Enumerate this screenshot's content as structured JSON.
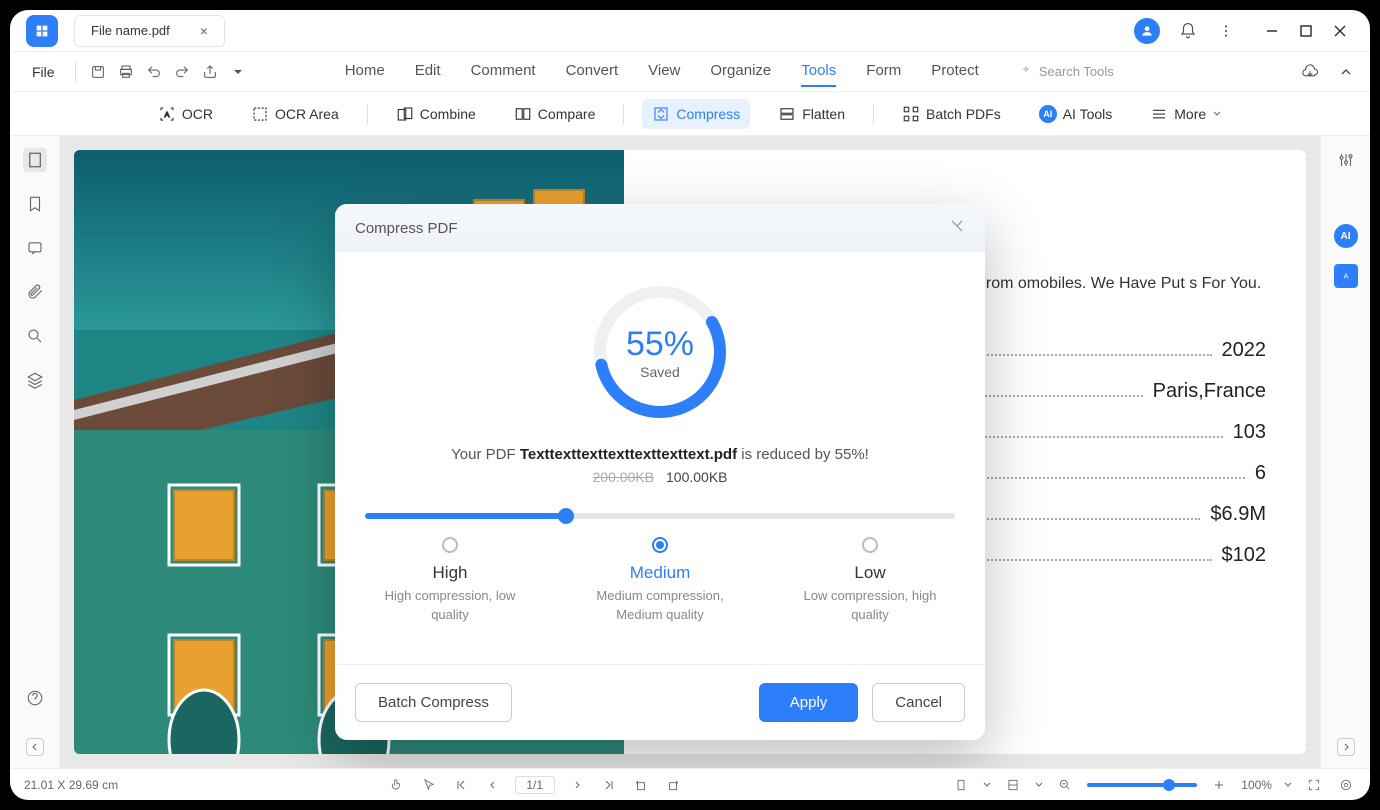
{
  "titlebar": {
    "filename": "File name.pdf"
  },
  "menu": {
    "file": "File",
    "tabs": [
      "Home",
      "Edit",
      "Comment",
      "Convert",
      "View",
      "Organize",
      "Tools",
      "Form",
      "Protect"
    ],
    "active_tab": "Tools",
    "search_placeholder": "Search Tools"
  },
  "toolbar": {
    "ocr": "OCR",
    "ocr_area": "OCR Area",
    "combine": "Combine",
    "compare": "Compare",
    "compress": "Compress",
    "flatten": "Flatten",
    "batch": "Batch PDFs",
    "ai": "AI Tools",
    "more": "More"
  },
  "doc": {
    "paragraph": "ian Holiday With Historical ralian Museums, From omobiles. We Have Put s For You.",
    "stats": [
      {
        "value": "2022"
      },
      {
        "value": "Paris,France"
      },
      {
        "value": "103"
      },
      {
        "value": "6"
      },
      {
        "value": "$6.9M"
      },
      {
        "value": "$102"
      }
    ]
  },
  "modal": {
    "title": "Compress PDF",
    "percent": "55%",
    "saved_label": "Saved",
    "reduce_prefix": "Your PDF ",
    "reduce_file": "Texttexttexttexttexttexttext.pdf",
    "reduce_suffix": " is reduced by 55%!",
    "old_size": "200.00KB",
    "new_size": "100.00KB",
    "quality": {
      "high": {
        "title": "High",
        "desc": "High compression, low quality"
      },
      "medium": {
        "title": "Medium",
        "desc": "Medium compression, Medium quality"
      },
      "low": {
        "title": "Low",
        "desc": "Low compression, high quality"
      },
      "selected": "medium"
    },
    "batch_btn": "Batch Compress",
    "apply_btn": "Apply",
    "cancel_btn": "Cancel"
  },
  "bottombar": {
    "dims": "21.01 X 29.69 cm",
    "page": "1/1",
    "zoom": "100%"
  }
}
